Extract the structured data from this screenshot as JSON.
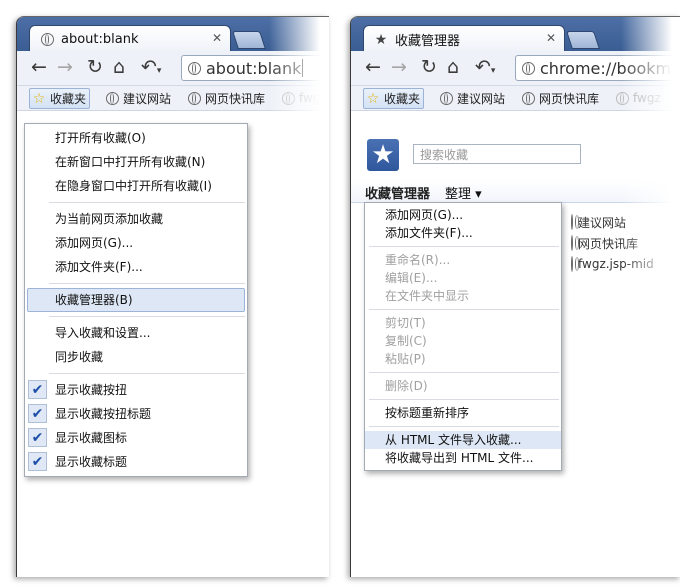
{
  "left_window": {
    "tab_title": "about:blank",
    "omnibox_text": "about:blank",
    "bookmarks_bar": [
      {
        "label": "收藏夹",
        "icon": "star-folder-icon"
      },
      {
        "label": "建议网站",
        "icon": "globe-icon"
      },
      {
        "label": "网页快讯库",
        "icon": "globe-icon"
      },
      {
        "label": "fwgz",
        "icon": "globe-icon"
      }
    ],
    "menu": {
      "g1": [
        "打开所有收藏(O)",
        "在新窗口中打开所有收藏(N)",
        "在隐身窗口中打开所有收藏(I)"
      ],
      "g2": [
        "为当前网页添加收藏",
        "添加网页(G)...",
        "添加文件夹(F)..."
      ],
      "g3": [
        "收藏管理器(B)"
      ],
      "g4": [
        "导入收藏和设置...",
        "同步收藏"
      ],
      "g5": [
        "显示收藏按扭",
        "显示收藏按扭标题",
        "显示收藏图标",
        "显示收藏标题"
      ]
    }
  },
  "right_window": {
    "tab_title": "收藏管理器",
    "omnibox_text": "chrome://bookma",
    "bookmarks_bar": [
      {
        "label": "收藏夹",
        "icon": "star-folder-icon"
      },
      {
        "label": "建议网站",
        "icon": "globe-icon"
      },
      {
        "label": "网页快讯库",
        "icon": "globe-icon"
      },
      {
        "label": "fwgz",
        "icon": "globe-icon"
      }
    ],
    "search_placeholder": "搜索收藏",
    "manager_title": "收藏管理器",
    "organize_label": "整理 ▾",
    "tree_items": [
      "建议网站",
      "网页快讯库",
      "fwgz.jsp-mid"
    ],
    "menu": {
      "g1": [
        "添加网页(G)...",
        "添加文件夹(F)..."
      ],
      "g2": [
        "重命名(R)...",
        "编辑(E)...",
        "在文件夹中显示"
      ],
      "g3": [
        "剪切(T)",
        "复制(C)",
        "粘贴(P)"
      ],
      "g4": [
        "删除(D)"
      ],
      "g5": [
        "按标题重新排序"
      ],
      "g6": [
        "从 HTML 文件导入收藏...",
        "将收藏导出到 HTML 文件..."
      ]
    }
  },
  "colors": {
    "tabstrip": "#3a5d93",
    "toolbar": "#eef2f8",
    "highlight": "#dde7f5",
    "accent": "#2f579b"
  }
}
